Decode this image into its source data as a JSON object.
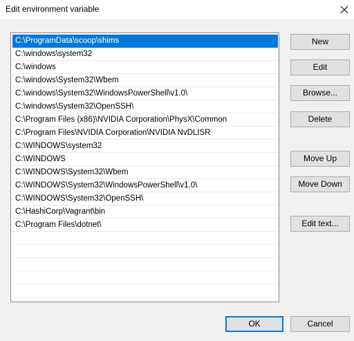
{
  "window": {
    "title": "Edit environment variable"
  },
  "list": {
    "items": [
      "C:\\ProgramData\\scoop\\shims",
      "C:\\windows\\system32",
      "C:\\windows",
      "C:\\windows\\System32\\Wbem",
      "C:\\windows\\System32\\WindowsPowerShell\\v1.0\\",
      "C:\\windows\\System32\\OpenSSH\\",
      "C:\\Program Files (x86)\\NVIDIA Corporation\\PhysX\\Common",
      "C:\\Program Files\\NVIDIA Corporation\\NVIDIA NvDLISR",
      "C:\\WINDOWS\\system32",
      "C:\\WINDOWS",
      "C:\\WINDOWS\\System32\\Wbem",
      "C:\\WINDOWS\\System32\\WindowsPowerShell\\v1.0\\",
      "C:\\WINDOWS\\System32\\OpenSSH\\",
      "C:\\HashiCorp\\Vagrant\\bin",
      "C:\\Program Files\\dotnet\\"
    ],
    "selected_index": 0
  },
  "buttons": {
    "new": "New",
    "edit": "Edit",
    "browse": "Browse...",
    "delete": "Delete",
    "move_up": "Move Up",
    "move_down": "Move Down",
    "edit_text": "Edit text...",
    "ok": "OK",
    "cancel": "Cancel"
  },
  "icons": {
    "close": "close-icon"
  },
  "colors": {
    "selection": "#0078d7",
    "background": "#f0f0f0"
  }
}
